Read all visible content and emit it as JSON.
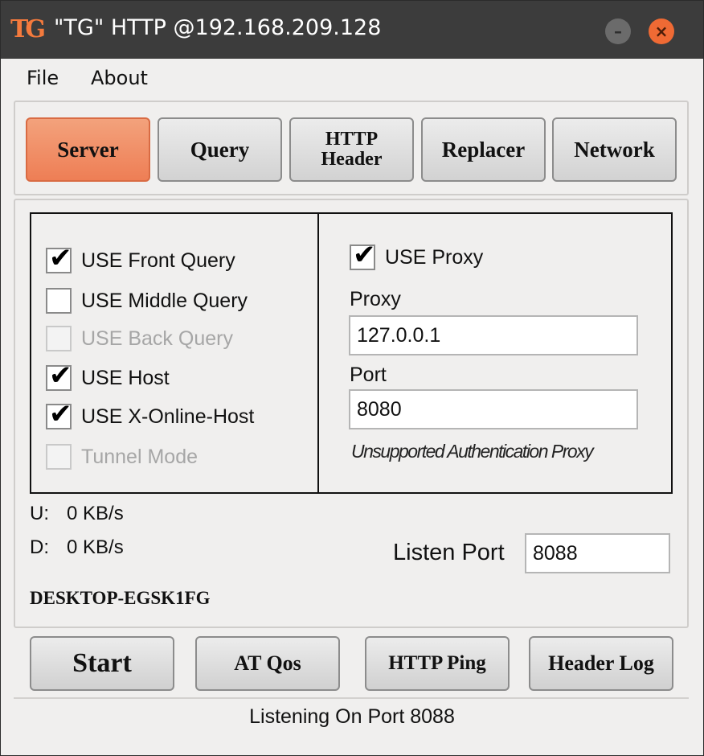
{
  "window": {
    "logo_text": "TG",
    "title": "\"TG\" HTTP @192.168.209.128",
    "minimize_glyph": "–",
    "close_glyph": "×"
  },
  "menu": {
    "file": "File",
    "about": "About"
  },
  "tabs": [
    {
      "label": "Server",
      "active": true
    },
    {
      "label": "Query",
      "active": false
    },
    {
      "label": "HTTP Header",
      "active": false
    },
    {
      "label": "Replacer",
      "active": false
    },
    {
      "label": "Network",
      "active": false
    }
  ],
  "server": {
    "options": [
      {
        "label": "USE Front Query",
        "checked": true,
        "enabled": true
      },
      {
        "label": "USE Middle Query",
        "checked": false,
        "enabled": true
      },
      {
        "label": "USE Back Query",
        "checked": false,
        "enabled": false
      },
      {
        "label": "USE Host",
        "checked": true,
        "enabled": true
      },
      {
        "label": "USE X-Online-Host",
        "checked": true,
        "enabled": true
      },
      {
        "label": "Tunnel Mode",
        "checked": false,
        "enabled": false
      }
    ],
    "use_proxy": {
      "label": "USE Proxy",
      "checked": true
    },
    "proxy_label": "Proxy",
    "proxy_value": "127.0.0.1",
    "port_label": "Port",
    "port_value": "8080",
    "auth_note": "Unsupported Authentication Proxy",
    "upload_label": "U:",
    "upload_value": "0 KB/s",
    "download_label": "D:",
    "download_value": "0 KB/s",
    "hostname": "DESKTOP-EGSK1FG",
    "listen_port_label": "Listen Port",
    "listen_port_value": "8088"
  },
  "buttons": {
    "start": "Start",
    "at_qos": "AT Qos",
    "http_ping": "HTTP Ping",
    "header_log": "Header Log"
  },
  "status": "Listening On Port 8088",
  "colors": {
    "accent": "#ee7e55",
    "titlebar": "#3c3c3c",
    "close_button": "#ef6a34"
  },
  "icons": {
    "app_logo": "tg-logo-icon",
    "checkmark": "checkmark-icon"
  }
}
